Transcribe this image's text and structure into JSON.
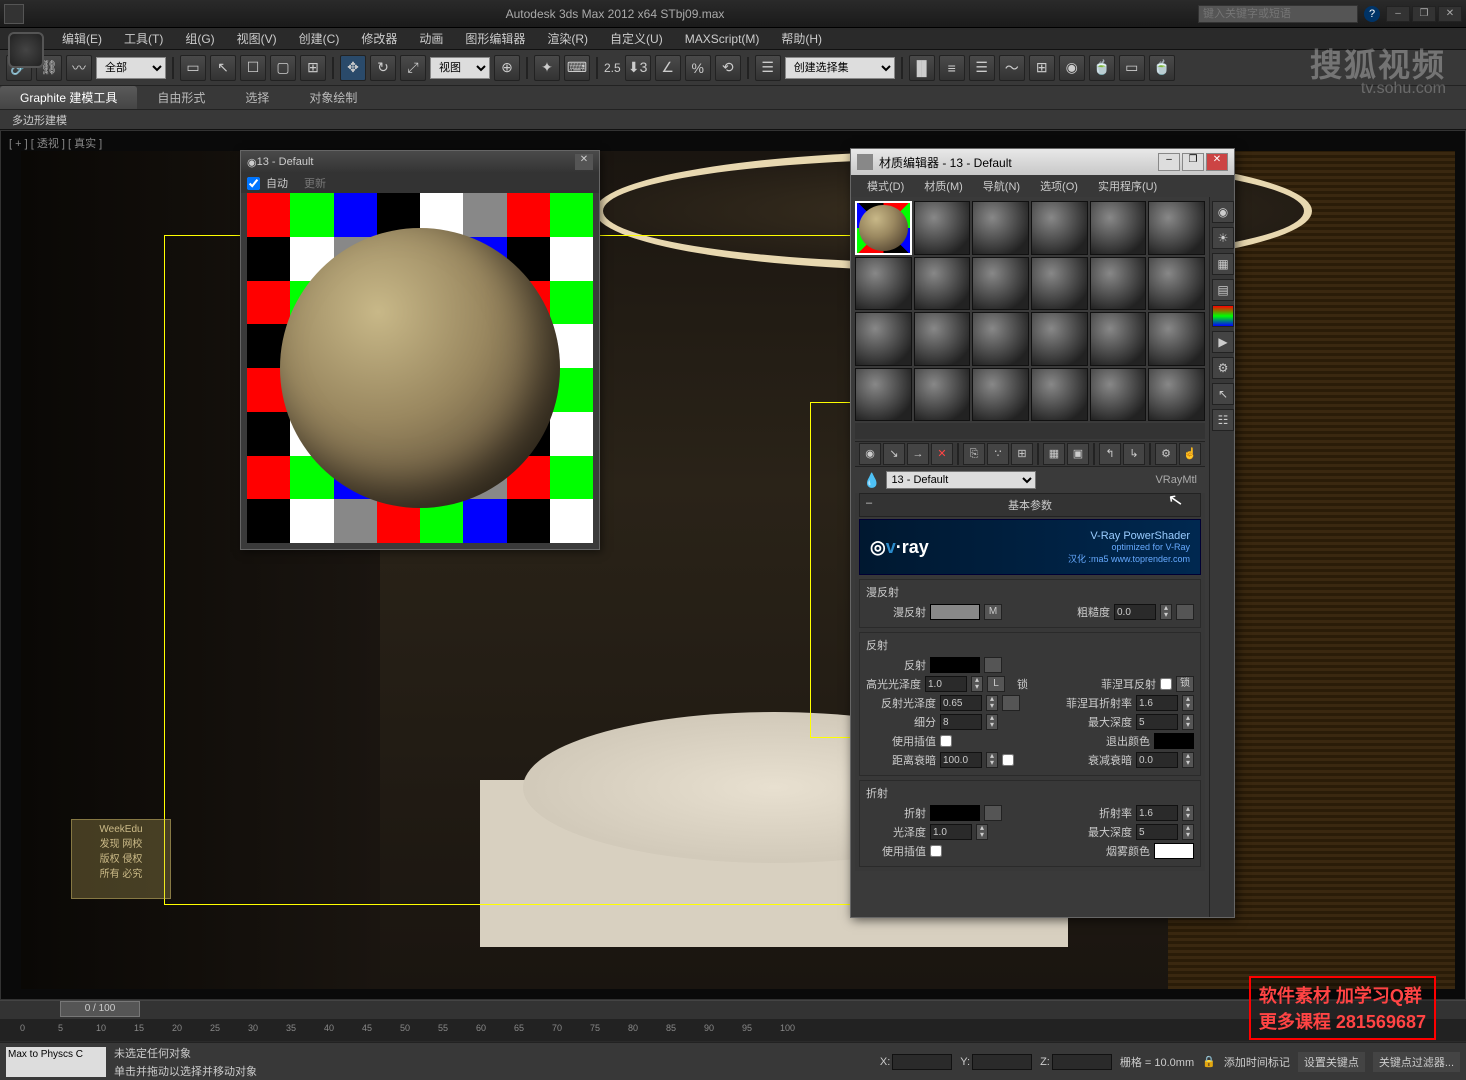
{
  "app": {
    "title": "Autodesk 3ds Max  2012 x64     STbj09.max",
    "search_placeholder": "键入关键字或短语"
  },
  "menu": [
    "编辑(E)",
    "工具(T)",
    "组(G)",
    "视图(V)",
    "创建(C)",
    "修改器",
    "动画",
    "图形编辑器",
    "渲染(R)",
    "自定义(U)",
    "MAXScript(M)",
    "帮助(H)"
  ],
  "toolbar": {
    "layer_select": "全部",
    "view_select": "视图",
    "snap_value": "2.5",
    "selset": "创建选择集"
  },
  "ribbon": {
    "tabs": [
      "Graphite 建模工具",
      "自由形式",
      "选择",
      "对象绘制"
    ],
    "sub": "多边形建模"
  },
  "viewport": {
    "label": "[ + ] [ 透视 ] [ 真实 ]"
  },
  "preview": {
    "title": "13 - Default",
    "auto": "自动",
    "update": "更新"
  },
  "mateditor": {
    "title": "材质编辑器 - 13 - Default",
    "menu": [
      "模式(D)",
      "材质(M)",
      "导航(N)",
      "选项(O)",
      "实用程序(U)"
    ],
    "mat_name": "13 - Default",
    "mat_type": "VRayMtl",
    "rollout_basic": "基本参数",
    "vray": {
      "brand": "v·ray",
      "tag": "V-Ray PowerShader",
      "sub": "optimized for V-Ray",
      "credit": "汉化 :ma5  www.toprender.com"
    },
    "diffuse": {
      "group": "漫反射",
      "label": "漫反射",
      "btn": "M",
      "rough_label": "粗糙度",
      "rough": "0.0"
    },
    "reflect": {
      "group": "反射",
      "label": "反射",
      "hilight_label": "高光光泽度",
      "hilight": "1.0",
      "refl_gloss_label": "反射光泽度",
      "refl_gloss": "0.65",
      "subdiv_label": "细分",
      "subdiv": "8",
      "interp_label": "使用插值",
      "dim_label": "距离衰暗",
      "dim": "100.0",
      "lock_label": "锁",
      "fresnel_label": "菲涅耳反射",
      "fior_label": "菲涅耳折射率",
      "fior": "1.6",
      "maxdepth_label": "最大深度",
      "maxdepth": "5",
      "exit_label": "退出颜色",
      "dimfall_label": "衰减衰暗",
      "dimfall": "0.0"
    },
    "refract": {
      "group": "折射",
      "label": "折射",
      "ior_label": "折射率",
      "ior": "1.6",
      "gloss_label": "光泽度",
      "gloss": "1.0",
      "maxdepth_label": "最大深度",
      "maxdepth": "5",
      "interp_label": "使用插值",
      "fog_label": "烟雾颜色"
    }
  },
  "timeline": {
    "pos": "0 / 100",
    "ticks": [
      "0",
      "5",
      "10",
      "15",
      "20",
      "25",
      "30",
      "35",
      "40",
      "45",
      "50",
      "55",
      "60",
      "65",
      "70",
      "75",
      "80",
      "85",
      "90",
      "95",
      "100"
    ]
  },
  "status": {
    "script": "Max to Physcs C",
    "sel": "未选定任何对象",
    "hint": "单击并拖动以选择并移动对象",
    "x": "X:",
    "y": "Y:",
    "z": "Z:",
    "grid": "栅格 = 10.0mm",
    "addtime": "添加时间标记",
    "setkey": "设置关键点",
    "keyfilter": "关键点过滤器..."
  },
  "watermark": {
    "main": "搜狐视频",
    "sub": "tv.sohu.com"
  },
  "overlay": {
    "line1": "软件素材  加学习Q群",
    "line2": "更多课程  281569687"
  },
  "weekedu": "WeekEdu\n发现 网校\n版权 侵权\n所有 必究"
}
